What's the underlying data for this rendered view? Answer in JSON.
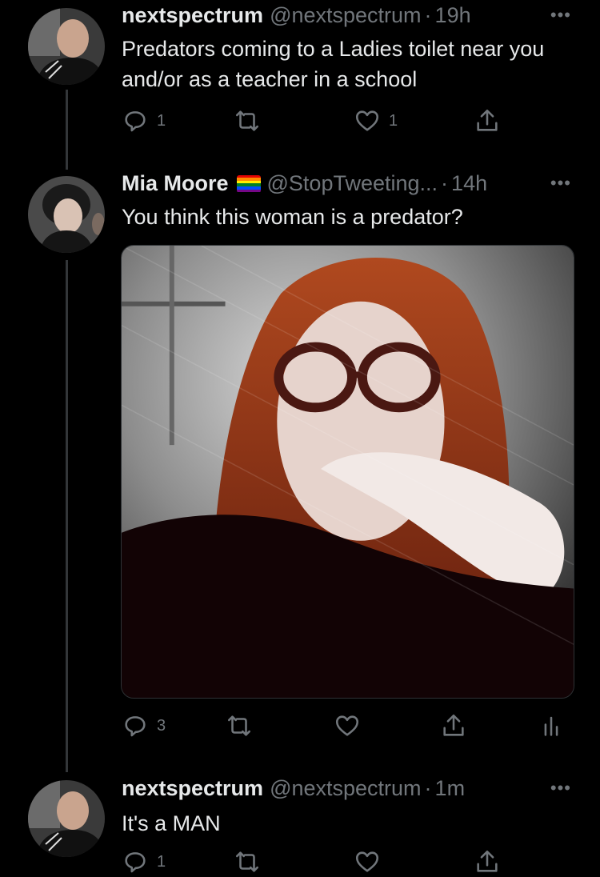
{
  "tweets": [
    {
      "display_name": "nextspectrum",
      "handle": "@nextspectrum",
      "separator": "·",
      "time": "19h",
      "text": "Predators coming to a Ladies toilet near you and/or as a teacher in a school",
      "reply_count": "1",
      "like_count": "1"
    },
    {
      "display_name": "Mia Moore",
      "handle": "@StopTweeting...",
      "separator": "·",
      "time": "14h",
      "text": "You think this woman is a predator?",
      "reply_count": "3"
    },
    {
      "display_name": "nextspectrum",
      "handle": "@nextspectrum",
      "separator": "·",
      "time": "1m",
      "text": "It's a MAN",
      "reply_count": "1"
    }
  ],
  "more_label": "•••",
  "colors": {
    "background": "#000000",
    "muted": "#71767b",
    "text": "#e7e9ea"
  },
  "icons": [
    "reply-icon",
    "retweet-icon",
    "like-icon",
    "share-icon",
    "analytics-icon",
    "more-icon",
    "rainbow-flag-icon"
  ]
}
